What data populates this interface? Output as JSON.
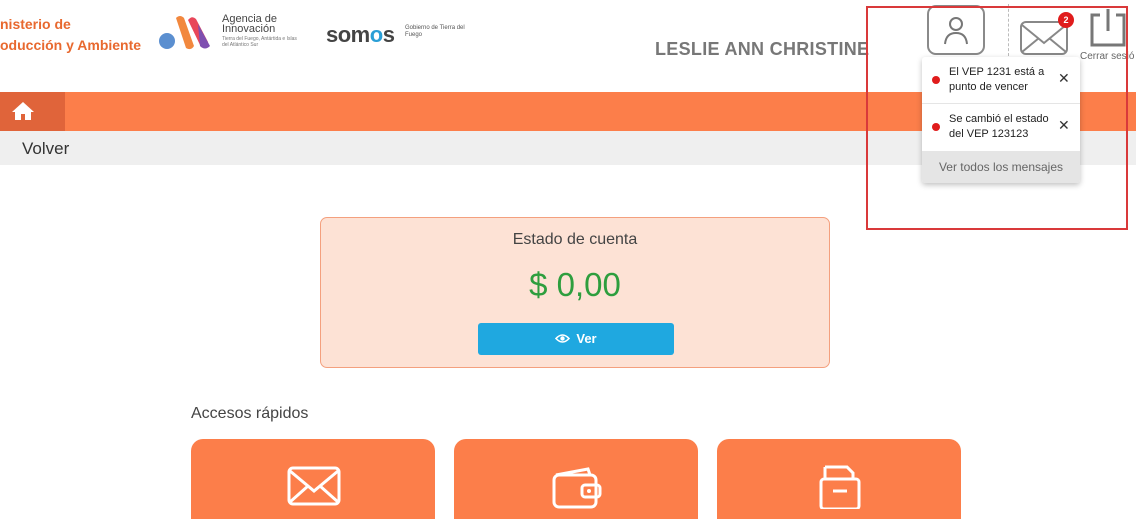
{
  "header": {
    "ministry_line1": "nisterio de",
    "ministry_line2": "oducción y Ambiente",
    "agency_line1": "Agencia de",
    "agency_line2": "Innovación",
    "agency_line3": "Tierra del Fuego, Antártida e Islas del Atlántico Sur",
    "somos_prefix": "som",
    "somos_o": "o",
    "somos_suffix": "s",
    "somos_sub": "Gobierno de Tierra del Fuego",
    "username": "LESLIE ANN CHRISTINE",
    "mail_badge": "2",
    "logout_label": "Cerrar sesió"
  },
  "notifications": {
    "items": [
      {
        "text": "El VEP 1231 está a punto de vencer",
        "close": "✕"
      },
      {
        "text": "Se cambió el estado del VEP 123123",
        "close": "✕"
      }
    ],
    "footer": "Ver todos los mensajes"
  },
  "nav": {
    "back_label": "Volver"
  },
  "account": {
    "title": "Estado de cuenta",
    "amount": "$ 0,00",
    "button_label": "Ver"
  },
  "quick_access": {
    "title": "Accesos rápidos"
  },
  "colors": {
    "brand_orange": "#fc7e4a",
    "home_orange": "#e0643a",
    "amount_green": "#2e9e3e",
    "button_blue": "#1fa8e0",
    "badge_red": "#e01c1c",
    "highlight_red": "#d9393a"
  }
}
